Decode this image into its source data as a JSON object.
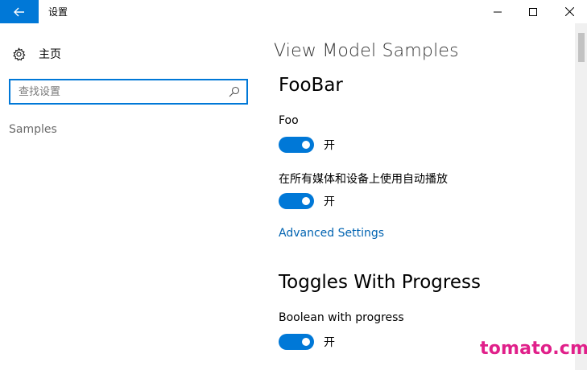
{
  "window": {
    "title": "设置",
    "minimize_icon": "minimize-icon",
    "maximize_icon": "maximize-icon",
    "close_icon": "close-icon",
    "back_icon": "arrow-left-icon",
    "accent": "#0078d7"
  },
  "sidebar": {
    "home_label": "主页",
    "home_icon": "gear-icon",
    "search_placeholder": "查找设置",
    "search_icon": "search-icon",
    "items": [
      {
        "label": "Samples"
      }
    ]
  },
  "main": {
    "page_title": "View Model Samples",
    "sections": [
      {
        "title": "FooBar",
        "settings": [
          {
            "label": "Foo",
            "state": "开",
            "on": true
          },
          {
            "label": "在所有媒体和设备上使用自动播放",
            "state": "开",
            "on": true
          }
        ],
        "link": "Advanced Settings"
      },
      {
        "title": "Toggles With Progress",
        "settings": [
          {
            "label": "Boolean with progress",
            "state": "开",
            "on": true
          }
        ]
      }
    ]
  },
  "watermark": "tomato.cm"
}
